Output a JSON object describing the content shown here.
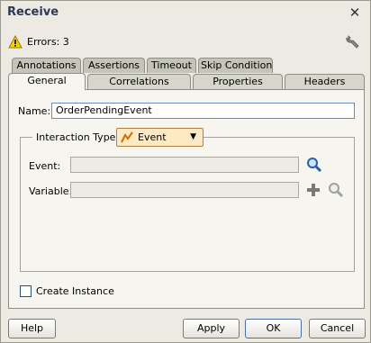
{
  "dialog": {
    "title": "Receive"
  },
  "status": {
    "errors_text": "Errors: 3"
  },
  "tabs": {
    "back_row": [
      "Annotations",
      "Assertions",
      "Timeout",
      "Skip Condition"
    ],
    "front_row": [
      "General",
      "Correlations",
      "Properties",
      "Headers"
    ],
    "active": "General"
  },
  "general": {
    "name_label": "Name:",
    "name_value": "OrderPendingEvent",
    "interaction_label": "Interaction Type:",
    "interaction_value": "Event",
    "event_label": "Event:",
    "event_value": "",
    "variable_label": "Variable:",
    "variable_value": "",
    "create_instance_label": "Create Instance",
    "create_instance_checked": false
  },
  "buttons": {
    "help": "Help",
    "apply": "Apply",
    "ok": "OK",
    "cancel": "Cancel"
  },
  "colors": {
    "title": "#2b3a58",
    "panel": "#f6f5ef",
    "dialog_bg": "#eceae2",
    "combo": "#fde9c4"
  }
}
